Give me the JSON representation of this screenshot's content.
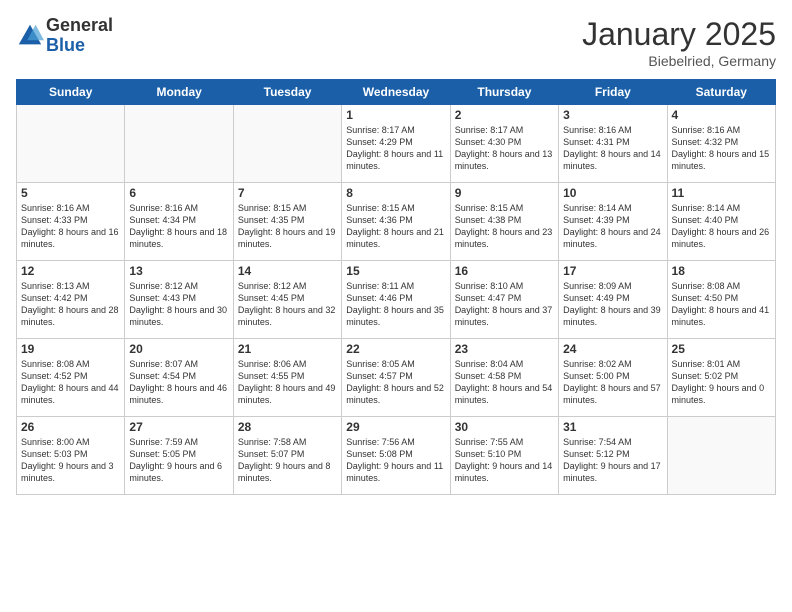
{
  "logo": {
    "general": "General",
    "blue": "Blue"
  },
  "title": "January 2025",
  "subtitle": "Biebelried, Germany",
  "days_header": [
    "Sunday",
    "Monday",
    "Tuesday",
    "Wednesday",
    "Thursday",
    "Friday",
    "Saturday"
  ],
  "weeks": [
    [
      {
        "day": "",
        "info": ""
      },
      {
        "day": "",
        "info": ""
      },
      {
        "day": "",
        "info": ""
      },
      {
        "day": "1",
        "info": "Sunrise: 8:17 AM\nSunset: 4:29 PM\nDaylight: 8 hours\nand 11 minutes."
      },
      {
        "day": "2",
        "info": "Sunrise: 8:17 AM\nSunset: 4:30 PM\nDaylight: 8 hours\nand 13 minutes."
      },
      {
        "day": "3",
        "info": "Sunrise: 8:16 AM\nSunset: 4:31 PM\nDaylight: 8 hours\nand 14 minutes."
      },
      {
        "day": "4",
        "info": "Sunrise: 8:16 AM\nSunset: 4:32 PM\nDaylight: 8 hours\nand 15 minutes."
      }
    ],
    [
      {
        "day": "5",
        "info": "Sunrise: 8:16 AM\nSunset: 4:33 PM\nDaylight: 8 hours\nand 16 minutes."
      },
      {
        "day": "6",
        "info": "Sunrise: 8:16 AM\nSunset: 4:34 PM\nDaylight: 8 hours\nand 18 minutes."
      },
      {
        "day": "7",
        "info": "Sunrise: 8:15 AM\nSunset: 4:35 PM\nDaylight: 8 hours\nand 19 minutes."
      },
      {
        "day": "8",
        "info": "Sunrise: 8:15 AM\nSunset: 4:36 PM\nDaylight: 8 hours\nand 21 minutes."
      },
      {
        "day": "9",
        "info": "Sunrise: 8:15 AM\nSunset: 4:38 PM\nDaylight: 8 hours\nand 23 minutes."
      },
      {
        "day": "10",
        "info": "Sunrise: 8:14 AM\nSunset: 4:39 PM\nDaylight: 8 hours\nand 24 minutes."
      },
      {
        "day": "11",
        "info": "Sunrise: 8:14 AM\nSunset: 4:40 PM\nDaylight: 8 hours\nand 26 minutes."
      }
    ],
    [
      {
        "day": "12",
        "info": "Sunrise: 8:13 AM\nSunset: 4:42 PM\nDaylight: 8 hours\nand 28 minutes."
      },
      {
        "day": "13",
        "info": "Sunrise: 8:12 AM\nSunset: 4:43 PM\nDaylight: 8 hours\nand 30 minutes."
      },
      {
        "day": "14",
        "info": "Sunrise: 8:12 AM\nSunset: 4:45 PM\nDaylight: 8 hours\nand 32 minutes."
      },
      {
        "day": "15",
        "info": "Sunrise: 8:11 AM\nSunset: 4:46 PM\nDaylight: 8 hours\nand 35 minutes."
      },
      {
        "day": "16",
        "info": "Sunrise: 8:10 AM\nSunset: 4:47 PM\nDaylight: 8 hours\nand 37 minutes."
      },
      {
        "day": "17",
        "info": "Sunrise: 8:09 AM\nSunset: 4:49 PM\nDaylight: 8 hours\nand 39 minutes."
      },
      {
        "day": "18",
        "info": "Sunrise: 8:08 AM\nSunset: 4:50 PM\nDaylight: 8 hours\nand 41 minutes."
      }
    ],
    [
      {
        "day": "19",
        "info": "Sunrise: 8:08 AM\nSunset: 4:52 PM\nDaylight: 8 hours\nand 44 minutes."
      },
      {
        "day": "20",
        "info": "Sunrise: 8:07 AM\nSunset: 4:54 PM\nDaylight: 8 hours\nand 46 minutes."
      },
      {
        "day": "21",
        "info": "Sunrise: 8:06 AM\nSunset: 4:55 PM\nDaylight: 8 hours\nand 49 minutes."
      },
      {
        "day": "22",
        "info": "Sunrise: 8:05 AM\nSunset: 4:57 PM\nDaylight: 8 hours\nand 52 minutes."
      },
      {
        "day": "23",
        "info": "Sunrise: 8:04 AM\nSunset: 4:58 PM\nDaylight: 8 hours\nand 54 minutes."
      },
      {
        "day": "24",
        "info": "Sunrise: 8:02 AM\nSunset: 5:00 PM\nDaylight: 8 hours\nand 57 minutes."
      },
      {
        "day": "25",
        "info": "Sunrise: 8:01 AM\nSunset: 5:02 PM\nDaylight: 9 hours\nand 0 minutes."
      }
    ],
    [
      {
        "day": "26",
        "info": "Sunrise: 8:00 AM\nSunset: 5:03 PM\nDaylight: 9 hours\nand 3 minutes."
      },
      {
        "day": "27",
        "info": "Sunrise: 7:59 AM\nSunset: 5:05 PM\nDaylight: 9 hours\nand 6 minutes."
      },
      {
        "day": "28",
        "info": "Sunrise: 7:58 AM\nSunset: 5:07 PM\nDaylight: 9 hours\nand 8 minutes."
      },
      {
        "day": "29",
        "info": "Sunrise: 7:56 AM\nSunset: 5:08 PM\nDaylight: 9 hours\nand 11 minutes."
      },
      {
        "day": "30",
        "info": "Sunrise: 7:55 AM\nSunset: 5:10 PM\nDaylight: 9 hours\nand 14 minutes."
      },
      {
        "day": "31",
        "info": "Sunrise: 7:54 AM\nSunset: 5:12 PM\nDaylight: 9 hours\nand 17 minutes."
      },
      {
        "day": "",
        "info": ""
      }
    ]
  ]
}
